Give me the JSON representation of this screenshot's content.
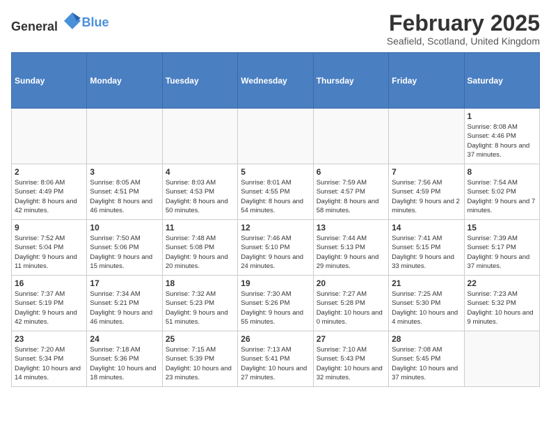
{
  "header": {
    "logo_general": "General",
    "logo_blue": "Blue",
    "title": "February 2025",
    "subtitle": "Seafield, Scotland, United Kingdom"
  },
  "weekdays": [
    "Sunday",
    "Monday",
    "Tuesday",
    "Wednesday",
    "Thursday",
    "Friday",
    "Saturday"
  ],
  "weeks": [
    [
      {
        "day": "",
        "info": ""
      },
      {
        "day": "",
        "info": ""
      },
      {
        "day": "",
        "info": ""
      },
      {
        "day": "",
        "info": ""
      },
      {
        "day": "",
        "info": ""
      },
      {
        "day": "",
        "info": ""
      },
      {
        "day": "1",
        "info": "Sunrise: 8:08 AM\nSunset: 4:46 PM\nDaylight: 8 hours and 37 minutes."
      }
    ],
    [
      {
        "day": "2",
        "info": "Sunrise: 8:06 AM\nSunset: 4:49 PM\nDaylight: 8 hours and 42 minutes."
      },
      {
        "day": "3",
        "info": "Sunrise: 8:05 AM\nSunset: 4:51 PM\nDaylight: 8 hours and 46 minutes."
      },
      {
        "day": "4",
        "info": "Sunrise: 8:03 AM\nSunset: 4:53 PM\nDaylight: 8 hours and 50 minutes."
      },
      {
        "day": "5",
        "info": "Sunrise: 8:01 AM\nSunset: 4:55 PM\nDaylight: 8 hours and 54 minutes."
      },
      {
        "day": "6",
        "info": "Sunrise: 7:59 AM\nSunset: 4:57 PM\nDaylight: 8 hours and 58 minutes."
      },
      {
        "day": "7",
        "info": "Sunrise: 7:56 AM\nSunset: 4:59 PM\nDaylight: 9 hours and 2 minutes."
      },
      {
        "day": "8",
        "info": "Sunrise: 7:54 AM\nSunset: 5:02 PM\nDaylight: 9 hours and 7 minutes."
      }
    ],
    [
      {
        "day": "9",
        "info": "Sunrise: 7:52 AM\nSunset: 5:04 PM\nDaylight: 9 hours and 11 minutes."
      },
      {
        "day": "10",
        "info": "Sunrise: 7:50 AM\nSunset: 5:06 PM\nDaylight: 9 hours and 15 minutes."
      },
      {
        "day": "11",
        "info": "Sunrise: 7:48 AM\nSunset: 5:08 PM\nDaylight: 9 hours and 20 minutes."
      },
      {
        "day": "12",
        "info": "Sunrise: 7:46 AM\nSunset: 5:10 PM\nDaylight: 9 hours and 24 minutes."
      },
      {
        "day": "13",
        "info": "Sunrise: 7:44 AM\nSunset: 5:13 PM\nDaylight: 9 hours and 29 minutes."
      },
      {
        "day": "14",
        "info": "Sunrise: 7:41 AM\nSunset: 5:15 PM\nDaylight: 9 hours and 33 minutes."
      },
      {
        "day": "15",
        "info": "Sunrise: 7:39 AM\nSunset: 5:17 PM\nDaylight: 9 hours and 37 minutes."
      }
    ],
    [
      {
        "day": "16",
        "info": "Sunrise: 7:37 AM\nSunset: 5:19 PM\nDaylight: 9 hours and 42 minutes."
      },
      {
        "day": "17",
        "info": "Sunrise: 7:34 AM\nSunset: 5:21 PM\nDaylight: 9 hours and 46 minutes."
      },
      {
        "day": "18",
        "info": "Sunrise: 7:32 AM\nSunset: 5:23 PM\nDaylight: 9 hours and 51 minutes."
      },
      {
        "day": "19",
        "info": "Sunrise: 7:30 AM\nSunset: 5:26 PM\nDaylight: 9 hours and 55 minutes."
      },
      {
        "day": "20",
        "info": "Sunrise: 7:27 AM\nSunset: 5:28 PM\nDaylight: 10 hours and 0 minutes."
      },
      {
        "day": "21",
        "info": "Sunrise: 7:25 AM\nSunset: 5:30 PM\nDaylight: 10 hours and 4 minutes."
      },
      {
        "day": "22",
        "info": "Sunrise: 7:23 AM\nSunset: 5:32 PM\nDaylight: 10 hours and 9 minutes."
      }
    ],
    [
      {
        "day": "23",
        "info": "Sunrise: 7:20 AM\nSunset: 5:34 PM\nDaylight: 10 hours and 14 minutes."
      },
      {
        "day": "24",
        "info": "Sunrise: 7:18 AM\nSunset: 5:36 PM\nDaylight: 10 hours and 18 minutes."
      },
      {
        "day": "25",
        "info": "Sunrise: 7:15 AM\nSunset: 5:39 PM\nDaylight: 10 hours and 23 minutes."
      },
      {
        "day": "26",
        "info": "Sunrise: 7:13 AM\nSunset: 5:41 PM\nDaylight: 10 hours and 27 minutes."
      },
      {
        "day": "27",
        "info": "Sunrise: 7:10 AM\nSunset: 5:43 PM\nDaylight: 10 hours and 32 minutes."
      },
      {
        "day": "28",
        "info": "Sunrise: 7:08 AM\nSunset: 5:45 PM\nDaylight: 10 hours and 37 minutes."
      },
      {
        "day": "",
        "info": ""
      }
    ]
  ]
}
